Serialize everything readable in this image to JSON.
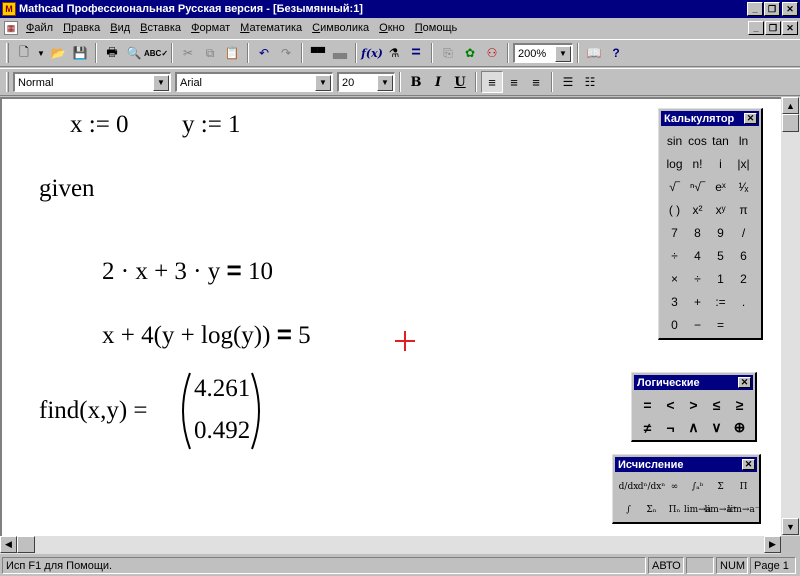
{
  "window": {
    "title": "Mathcad Профессиональная Русская версия - [Безымянный:1]",
    "controls": [
      "_",
      "❐",
      "✕"
    ]
  },
  "menu": {
    "items": [
      "Файл",
      "Правка",
      "Вид",
      "Вставка",
      "Формат",
      "Математика",
      "Символика",
      "Окно",
      "Помощь"
    ]
  },
  "toolbar": {
    "zoom": "200%"
  },
  "format_bar": {
    "style": "Normal",
    "font": "Arial",
    "size": "20",
    "bold": "B",
    "italic": "I",
    "underline": "U"
  },
  "worksheet": {
    "x_def": "x := 0",
    "y_def": "y := 1",
    "given": "given",
    "eq1_lhs": "2 · x + 3 · y",
    "eq1_rhs": "10",
    "eq2_lhs": "x + 4(y + log(y))",
    "eq2_rhs": "5",
    "find_call": "find(x,y) =",
    "result_x": "4.261",
    "result_y": "0.492"
  },
  "palettes": {
    "calculator": {
      "title": "Калькулятор",
      "cells": [
        "sin",
        "cos",
        "tan",
        "ln",
        "log",
        "n!",
        "i",
        "|x|",
        "√‾",
        "ⁿ√‾",
        "eˣ",
        "¹⁄ₓ",
        "( )",
        "x²",
        "xʸ",
        "π",
        "7",
        "8",
        "9",
        "/",
        "÷",
        "4",
        "5",
        "6",
        "×",
        "÷",
        "1",
        "2",
        "3",
        "+",
        ":=",
        ".",
        "0",
        "−",
        "=",
        ""
      ]
    },
    "logic": {
      "title": "Логические",
      "cells": [
        "=",
        "<",
        ">",
        "≤",
        "≥",
        "≠",
        "¬",
        "∧",
        "∨",
        "⊕"
      ]
    },
    "calculus": {
      "title": "Исчисление",
      "cells": [
        "d/dx",
        "dⁿ/dxⁿ",
        "∞",
        "∫ₐᵇ",
        "Σ",
        "Π",
        "∫",
        "Σₙ",
        "Πₙ",
        "lim→a",
        "lim→a⁺",
        "lim→a⁻"
      ]
    }
  },
  "statusbar": {
    "help": "Исп F1 для Помощи.",
    "mode": "АВТО",
    "blank": "",
    "num": "NUM",
    "page": "Page 1"
  }
}
